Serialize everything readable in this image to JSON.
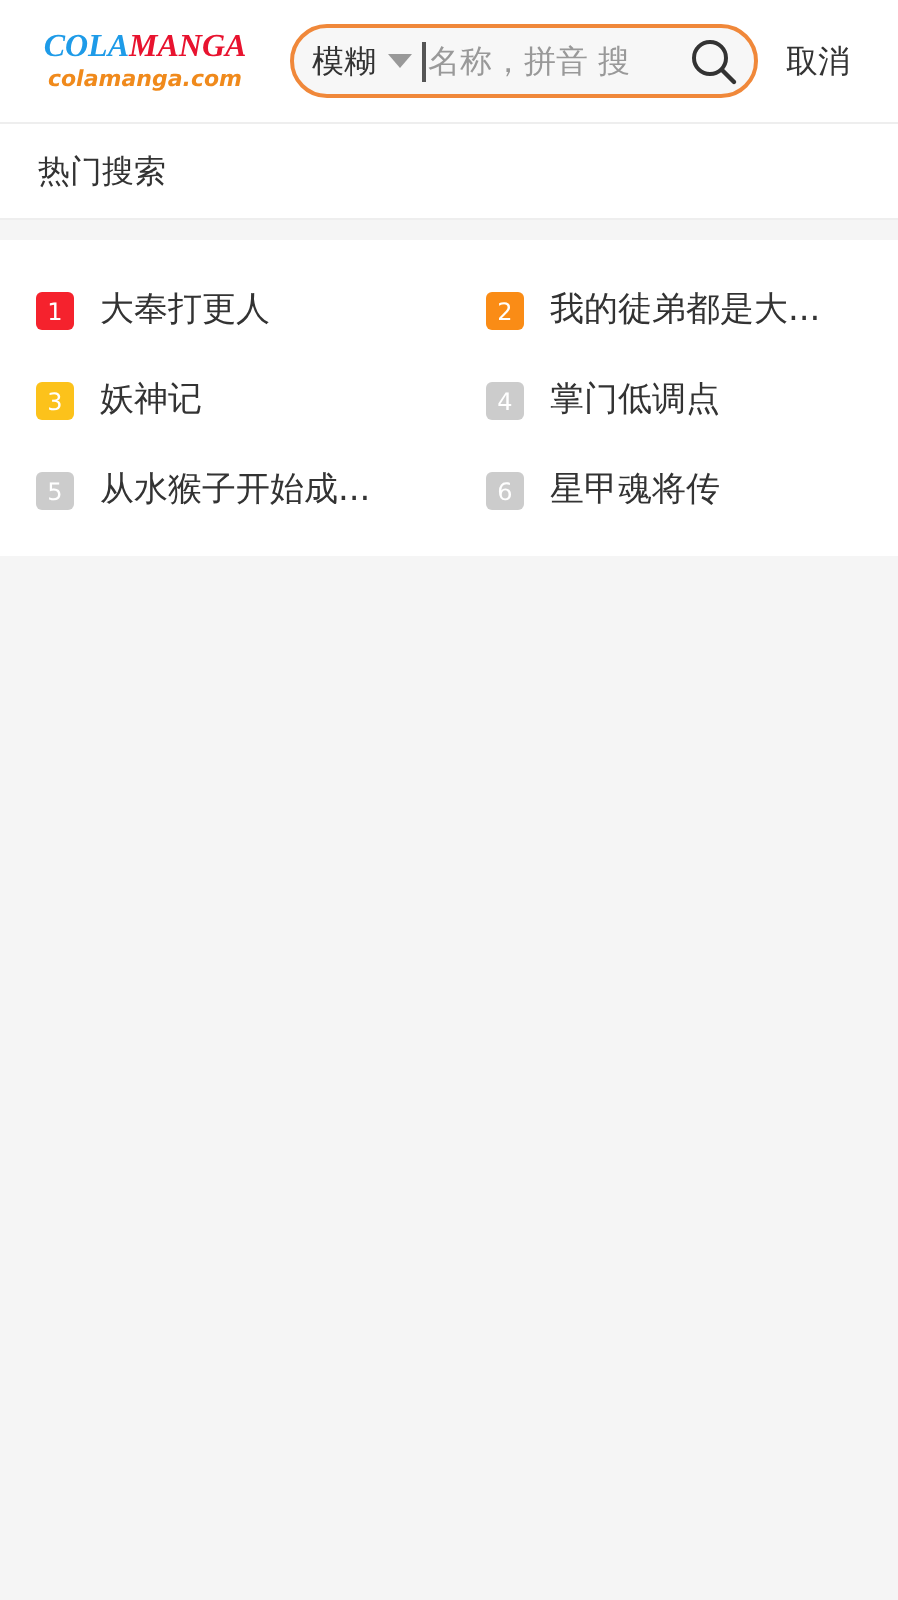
{
  "logo": {
    "word_1": "COLA",
    "word_2": "MANGA",
    "domain": "colamanga.com"
  },
  "search": {
    "mode": "模糊",
    "placeholder": "名称，拼音 搜"
  },
  "cancel": "取消",
  "hot_search": {
    "title": "热门搜索",
    "items": [
      {
        "rank": "1",
        "title": "大奉打更人",
        "color": "#f5222d"
      },
      {
        "rank": "2",
        "title": "我的徒弟都是大...",
        "color": "#fa8c16"
      },
      {
        "rank": "3",
        "title": "妖神记",
        "color": "#fcc21b"
      },
      {
        "rank": "4",
        "title": "掌门低调点",
        "color": "#cccccc"
      },
      {
        "rank": "5",
        "title": "从水猴子开始成...",
        "color": "#cccccc"
      },
      {
        "rank": "6",
        "title": "星甲魂将传",
        "color": "#cccccc"
      }
    ]
  }
}
